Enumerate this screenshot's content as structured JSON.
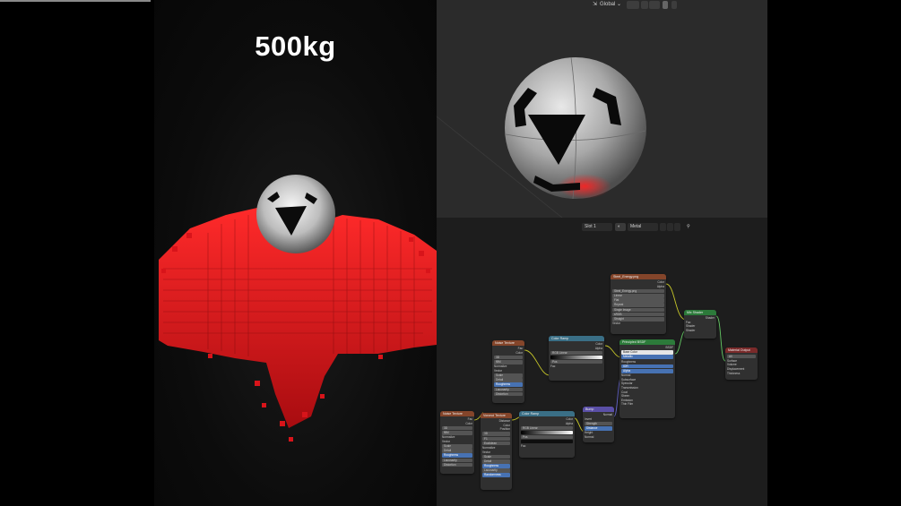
{
  "render_panel": {
    "weight_label": "500kg"
  },
  "viewport": {
    "header": {
      "transform_orientation": "Global"
    }
  },
  "node_editor": {
    "header": {
      "slot": "Slot 1",
      "material": "Metal"
    },
    "nodes": {
      "image_texture_main": {
        "title": "Steel_Energy.png",
        "outputs": [
          "Color",
          "Alpha"
        ],
        "image_name": "Steel_Energy.png",
        "interpolation": "Linear",
        "projection": "Flat",
        "extension": "Repeat",
        "source": "Single Image",
        "color_space": "sRGB",
        "alpha": "Straight",
        "input": "Vector"
      },
      "mix_shader": {
        "title": "Mix Shader",
        "output": "Shader",
        "inputs": [
          "Fac",
          "Shader",
          "Shader"
        ]
      },
      "material_output": {
        "title": "Material Output",
        "target": "All",
        "inputs": [
          "Surface",
          "Volume",
          "Displacement",
          "Thickness"
        ]
      },
      "principled_bsdf": {
        "title": "Principled BSDF",
        "output": "BSDF",
        "rows": [
          "Base Color",
          "Metallic",
          "Roughness",
          "IOR",
          "Alpha",
          "Normal",
          "Subsurface",
          "Specular",
          "Transmission",
          "Coat",
          "Sheen",
          "Emission",
          "Thin Film"
        ]
      },
      "color_ramp_top": {
        "title": "Color Ramp",
        "outputs": [
          "Color",
          "Alpha"
        ],
        "mode": "RGB",
        "interpolation": "Linear",
        "pos": "Pos",
        "input": "Fac"
      },
      "noise_texture_top": {
        "title": "Noise Texture",
        "outputs": [
          "Fac",
          "Color"
        ],
        "dims": "3D",
        "type": "fBM",
        "normalize": "Normalize",
        "rows": [
          "Vector",
          "Scale",
          "Detail",
          "Roughness",
          "Lacunarity",
          "Distortion"
        ]
      },
      "noise_texture_bottom": {
        "title": "Noise Texture",
        "outputs": [
          "Fac",
          "Color"
        ],
        "dims": "3D",
        "type": "fBM",
        "normalize": "Normalize",
        "rows": [
          "Vector",
          "Scale",
          "Detail",
          "Roughness",
          "Lacunarity",
          "Distortion"
        ]
      },
      "voronoi_texture": {
        "title": "Voronoi Texture",
        "outputs": [
          "Distance",
          "Color",
          "Position"
        ],
        "dims": "3D",
        "feature": "F1",
        "metric": "Euclidean",
        "normalize": "Normalize",
        "rows": [
          "Vector",
          "Scale",
          "Detail",
          "Roughness",
          "Lacunarity",
          "Randomness"
        ]
      },
      "color_ramp_bottom": {
        "title": "Color Ramp",
        "outputs": [
          "Color",
          "Alpha"
        ],
        "mode": "RGB",
        "interpolation": "Linear",
        "pos": "Pos",
        "input": "Fac"
      },
      "bump": {
        "title": "Bump",
        "output": "Normal",
        "invert": "Invert",
        "rows": [
          "Strength",
          "Distance",
          "Height",
          "Normal"
        ]
      }
    }
  },
  "colors": {
    "cube_red": "#e0171b",
    "node_header_image": "#84452a",
    "node_header_shader": "#2c7a3a",
    "node_header_converter": "#3a6f86",
    "node_header_vector": "#5a4fa6",
    "node_header_output": "#7a2a2a"
  }
}
